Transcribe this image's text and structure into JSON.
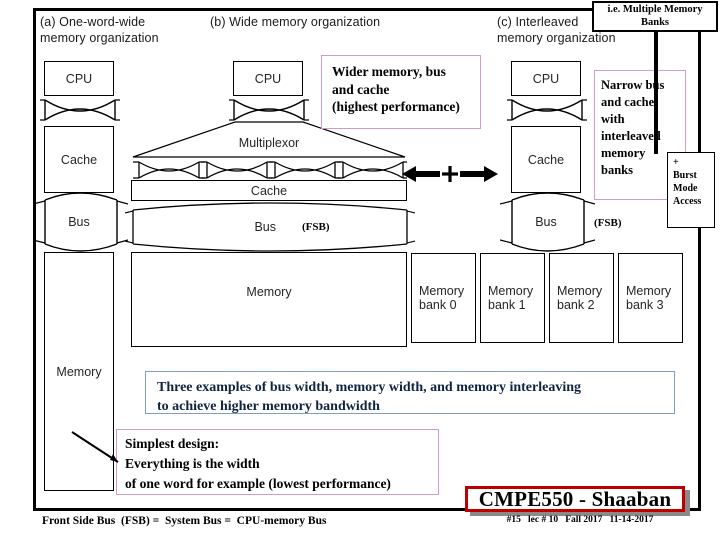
{
  "slide": {
    "columns": [
      {
        "id": "a",
        "caption": "(a) One-word-wide\n     memory organization"
      },
      {
        "id": "b",
        "caption": "(b) Wide memory organization"
      },
      {
        "id": "c",
        "caption": "(c) Interleaved\n      memory organization"
      }
    ],
    "column_a": {
      "cpu": "CPU",
      "cache": "Cache",
      "bus": "Bus",
      "memory": "Memory"
    },
    "column_b": {
      "cpu": "CPU",
      "multiplexor": "Multiplexor",
      "cache": "Cache",
      "bus": "Bus",
      "bus_note": "(FSB)",
      "memory": "Memory"
    },
    "column_c": {
      "cpu": "CPU",
      "cache": "Cache",
      "bus": "Bus",
      "bus_note": "(FSB)",
      "banks": [
        "Memory\nbank 0",
        "Memory\nbank 1",
        "Memory\nbank 2",
        "Memory\nbank 3"
      ]
    },
    "callouts": {
      "wide": "Wider memory,  bus\nand cache\n(highest performance)",
      "narrow": "Narrow bus\nand cache\nwith\ninterleaved\nmemory\nbanks",
      "burst": "+\nBurst\nMode\nAccess",
      "multiple_banks": "i.e. Multiple  Memory\nBanks",
      "summary": "Three examples of bus width, memory width, and memory interleaving\nto achieve higher memory bandwidth",
      "simplest": "Simplest design:\nEverything is the width\nof one word for example (lowest performance)"
    },
    "symbols": {
      "plus": "+",
      "arrow_left": "left-arrow",
      "arrow_right": "right-arrow"
    },
    "footer": {
      "fsb_definition": "Front Side Bus  (FSB) =  System Bus =  CPU-memory Bus",
      "course_title": "CMPE550 - Shaaban",
      "meta": "#15   lec # 10   Fall 2017   11-14-2017"
    },
    "colors": {
      "pink_border": "#cf9cc8",
      "blue_border": "#7d9fc0",
      "red_border": "#c00000",
      "ink": "#000000"
    }
  }
}
